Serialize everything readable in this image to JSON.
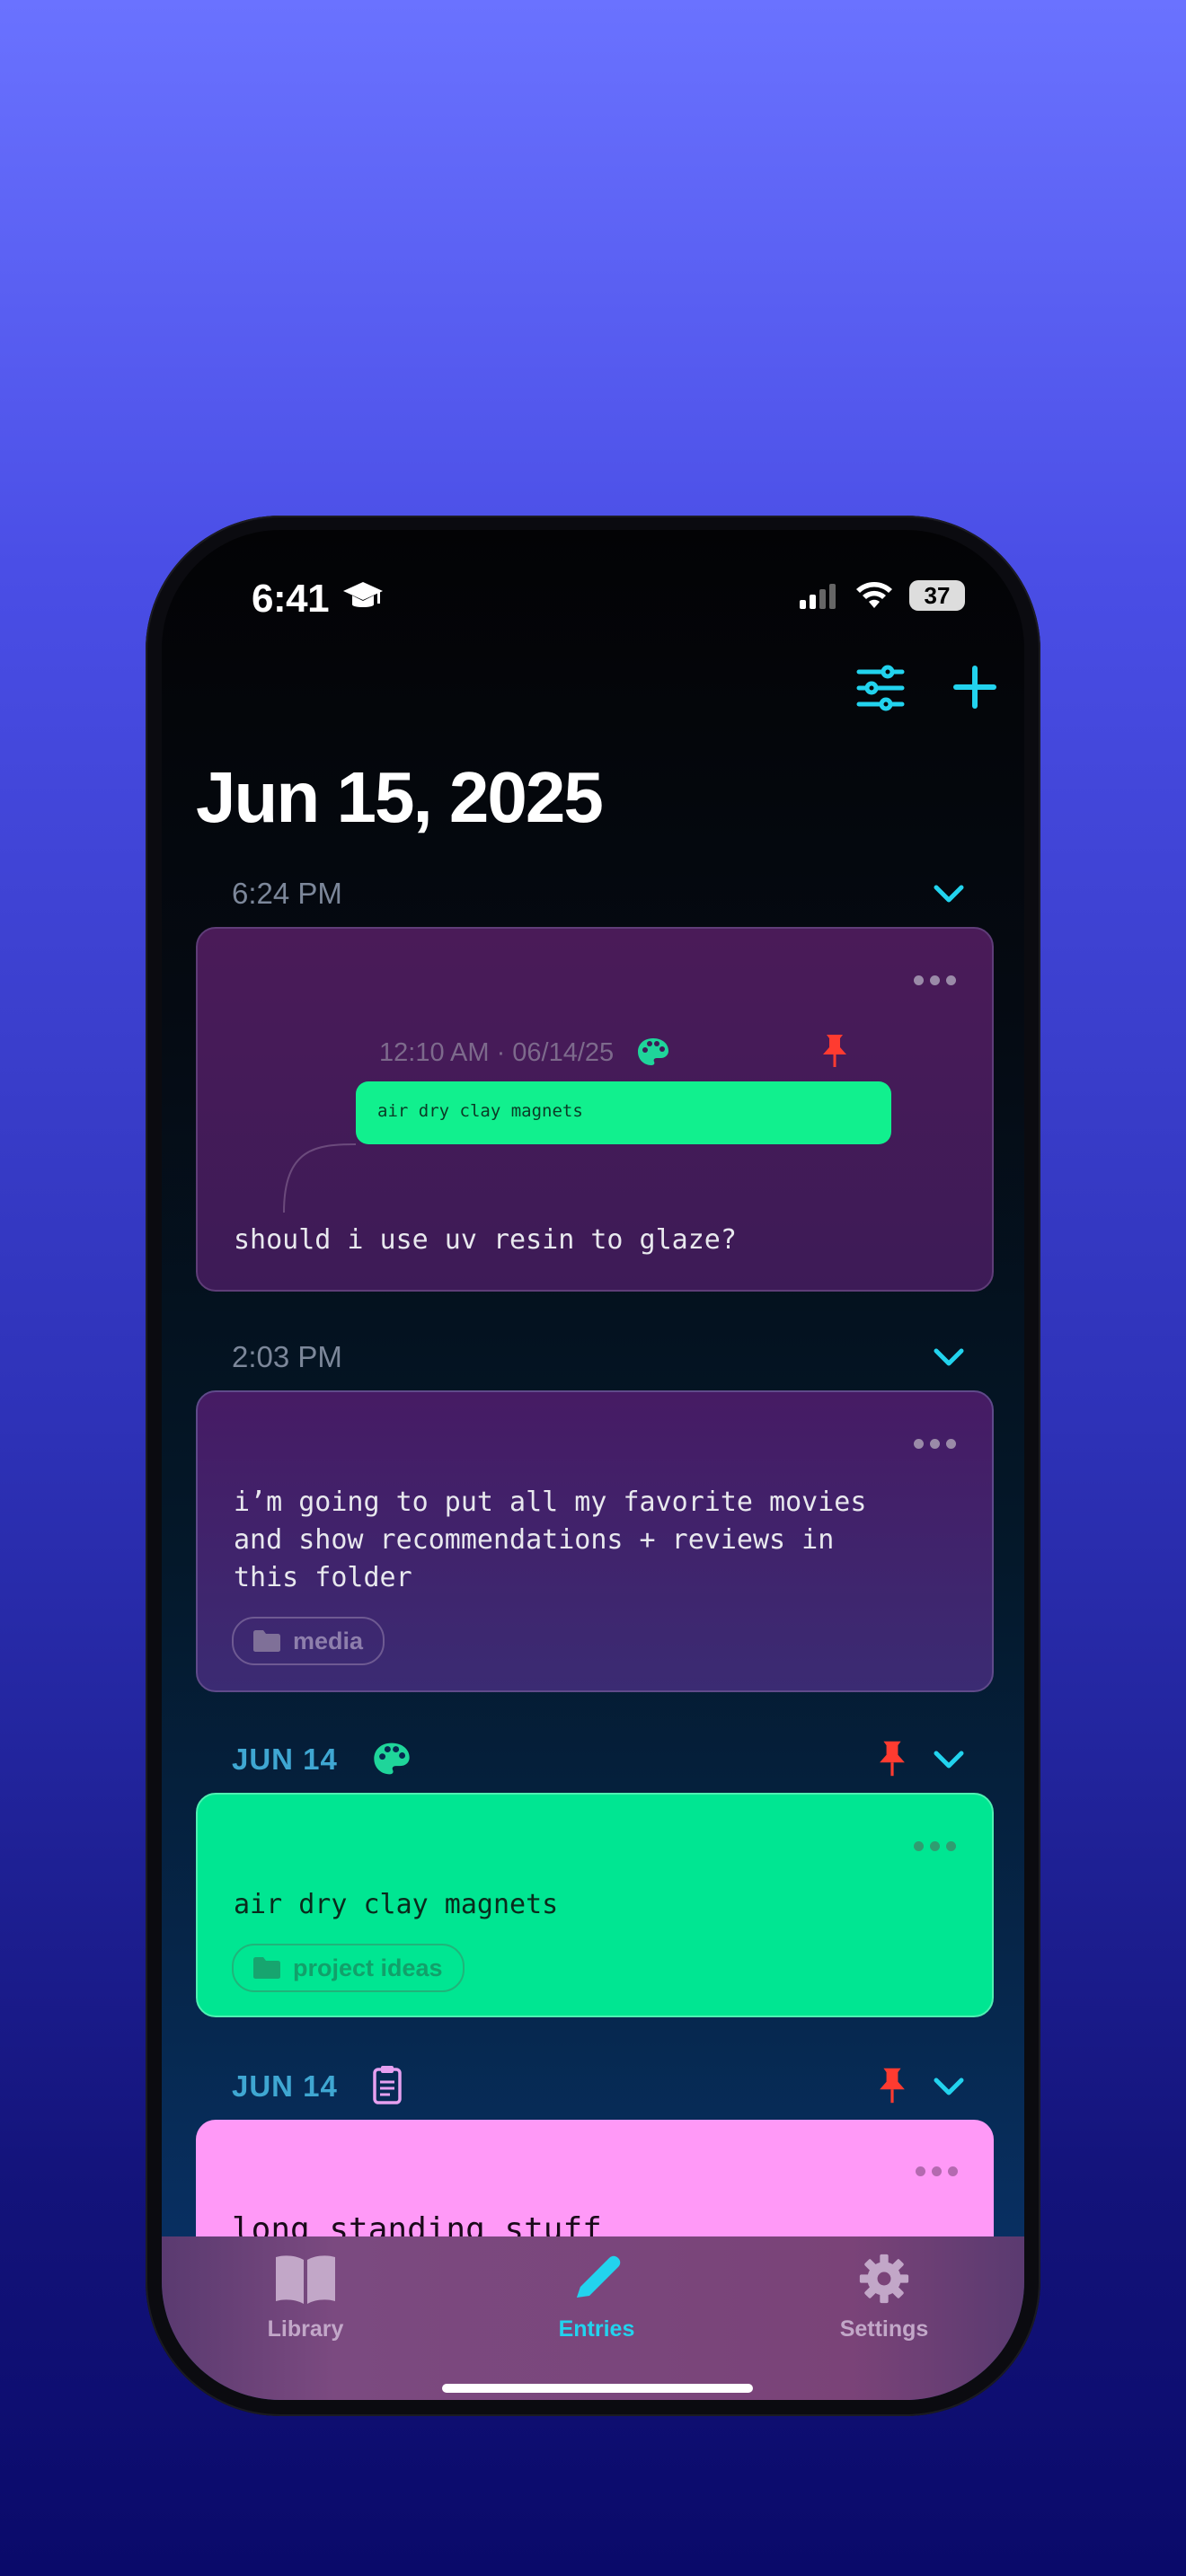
{
  "status_bar": {
    "time": "6:41",
    "battery": "37"
  },
  "header": {
    "title": "Jun 15, 2025"
  },
  "sections": [
    {
      "label": "6:24 PM",
      "reply": {
        "meta": "12:10 AM · 06/14/25",
        "quoted": "air dry clay magnets",
        "text": "should i use uv resin to glaze?"
      }
    },
    {
      "label": "2:03 PM",
      "lines": [
        "i’m going to put all my favorite movies",
        "and show recommendations + reviews in",
        "this folder"
      ],
      "folder": "media"
    },
    {
      "label": "JUN 14",
      "text": "air dry clay magnets",
      "folder": "project ideas"
    },
    {
      "label": "JUN 14",
      "text": "long standing stuff"
    }
  ],
  "tabbar": {
    "tabs": [
      {
        "label": "Library"
      },
      {
        "label": "Entries"
      },
      {
        "label": "Settings"
      }
    ]
  },
  "colors": {
    "accent": "#22d3ee",
    "pin": "#ff3b30",
    "green_card": "#00e692",
    "pink_card": "#ff99f7"
  }
}
